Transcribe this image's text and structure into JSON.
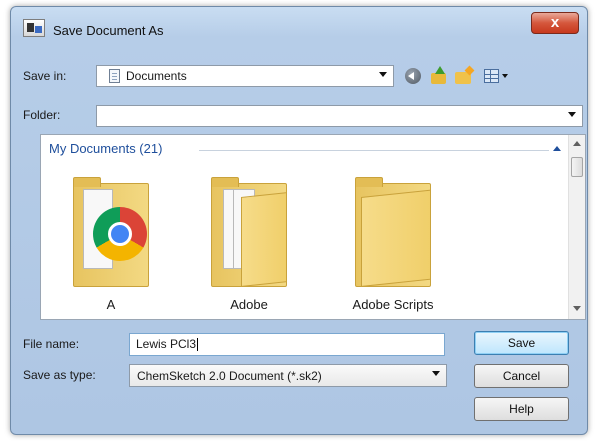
{
  "window": {
    "title": "Save Document As",
    "close_label": "x"
  },
  "toolbar": {
    "save_in_label": "Save in:",
    "save_in_value": "Documents",
    "icons": [
      "back-icon",
      "up-folder-icon",
      "new-folder-icon",
      "views-icon"
    ]
  },
  "folder_field": {
    "label": "Folder:",
    "value": ""
  },
  "file_list": {
    "group_title": "My Documents (21)",
    "items": [
      {
        "label": "A",
        "icon": "folder-with-chrome-icon"
      },
      {
        "label": "Adobe",
        "icon": "folder-icon"
      },
      {
        "label": "Adobe Scripts",
        "icon": "folder-icon"
      }
    ]
  },
  "file_name": {
    "label": "File name:",
    "value": "Lewis PCl3"
  },
  "save_as_type": {
    "label": "Save as type:",
    "value": "ChemSketch 2.0 Document (*.sk2)"
  },
  "buttons": {
    "save": "Save",
    "cancel": "Cancel",
    "help": "Help"
  },
  "colors": {
    "title_bg": "#b6cde8",
    "group_title": "#1f4f9c",
    "close_button": "#c7381d"
  }
}
